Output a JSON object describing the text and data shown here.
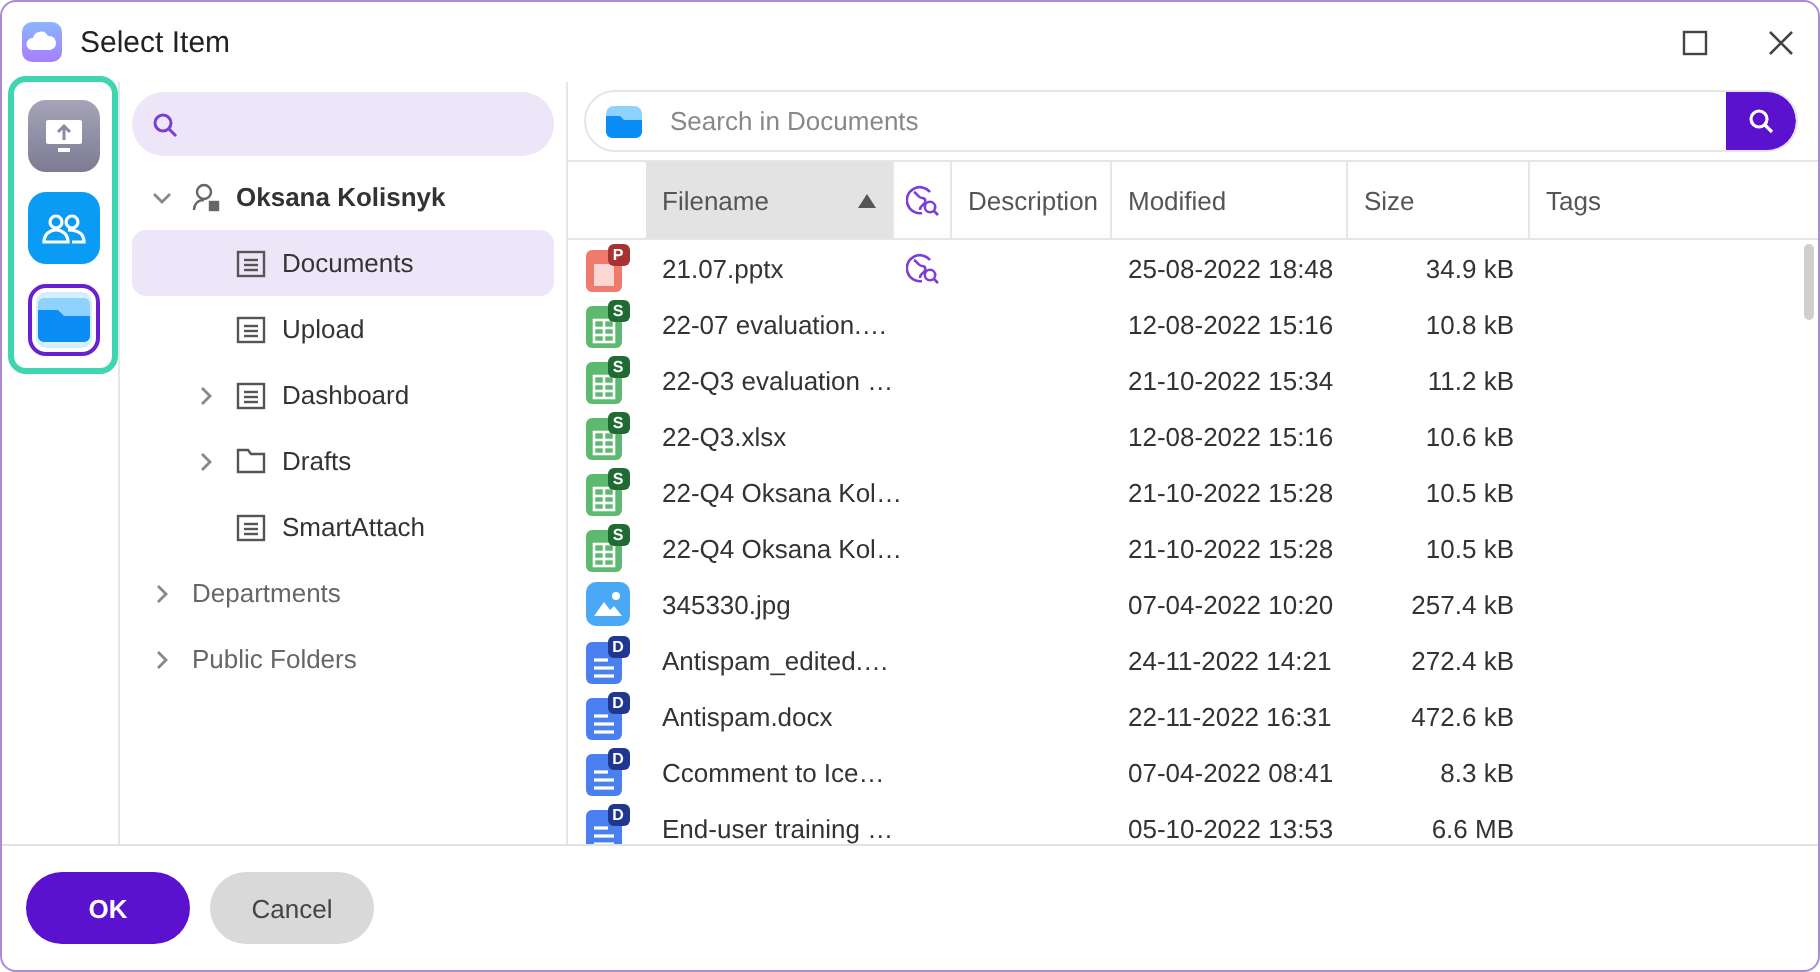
{
  "window": {
    "title": "Select Item"
  },
  "rail": [
    {
      "kind": "upload",
      "selected": false
    },
    {
      "kind": "users",
      "selected": false
    },
    {
      "kind": "folder",
      "selected": true
    }
  ],
  "tree": [
    {
      "label": "Oksana Kolisnyk",
      "kind": "user",
      "expanded": true,
      "selected": false,
      "children": [
        {
          "label": "Documents",
          "kind": "notes",
          "selected": true
        },
        {
          "label": "Upload",
          "kind": "notes",
          "selected": false
        },
        {
          "label": "Dashboard",
          "kind": "notes",
          "expanded": false,
          "selected": false
        },
        {
          "label": "Drafts",
          "kind": "folder",
          "expanded": false,
          "selected": false
        },
        {
          "label": "SmartAttach",
          "kind": "notes",
          "selected": false
        }
      ]
    },
    {
      "label": "Departments",
      "kind": "none",
      "expanded": false,
      "selected": false
    },
    {
      "label": "Public Folders",
      "kind": "none",
      "expanded": false,
      "selected": false
    }
  ],
  "search": {
    "placeholder": "Search in Documents"
  },
  "table": {
    "columns": [
      {
        "label": "Filename",
        "sorted": true
      },
      {
        "kind": "shared"
      },
      {
        "label": "Description"
      },
      {
        "label": "Modified"
      },
      {
        "label": "Size"
      },
      {
        "label": "Tags"
      }
    ],
    "rows": [
      {
        "kind": "slides",
        "badge": "P",
        "name": "21.07.pptx",
        "shared": true,
        "modified": "25-08-2022 18:48",
        "size": "34.9 kB"
      },
      {
        "kind": "sheet",
        "badge": "S",
        "name": "22-07 evaluation.…",
        "shared": false,
        "modified": "12-08-2022 15:16",
        "size": "10.8 kB"
      },
      {
        "kind": "sheet",
        "badge": "S",
        "name": "22-Q3 evaluation …",
        "shared": false,
        "modified": "21-10-2022 15:34",
        "size": "11.2 kB"
      },
      {
        "kind": "sheet",
        "badge": "S",
        "name": "22-Q3.xlsx",
        "shared": false,
        "modified": "12-08-2022 15:16",
        "size": "10.6 kB"
      },
      {
        "kind": "sheet",
        "badge": "S",
        "name": "22-Q4 Oksana Kol…",
        "shared": false,
        "modified": "21-10-2022 15:28",
        "size": "10.5 kB"
      },
      {
        "kind": "sheet",
        "badge": "S",
        "name": "22-Q4 Oksana Kol…",
        "shared": false,
        "modified": "21-10-2022 15:28",
        "size": "10.5 kB"
      },
      {
        "kind": "image",
        "badge": "",
        "name": "345330.jpg",
        "shared": false,
        "modified": "07-04-2022 10:20",
        "size": "257.4 kB"
      },
      {
        "kind": "doc",
        "badge": "D",
        "name": "Antispam_edited.…",
        "shared": false,
        "modified": "24-11-2022 14:21",
        "size": "272.4 kB"
      },
      {
        "kind": "doc",
        "badge": "D",
        "name": "Antispam.docx",
        "shared": false,
        "modified": "22-11-2022 16:31",
        "size": "472.6 kB"
      },
      {
        "kind": "doc",
        "badge": "D",
        "name": "Ccomment to Ice…",
        "shared": false,
        "modified": "07-04-2022 08:41",
        "size": "8.3 kB"
      },
      {
        "kind": "doc",
        "badge": "D",
        "name": "End-user training …",
        "shared": false,
        "modified": "05-10-2022 13:53",
        "size": "6.6 MB"
      }
    ]
  },
  "buttons": [
    {
      "label": "OK",
      "kind": "primary"
    },
    {
      "label": "Cancel",
      "kind": "secondary"
    }
  ]
}
